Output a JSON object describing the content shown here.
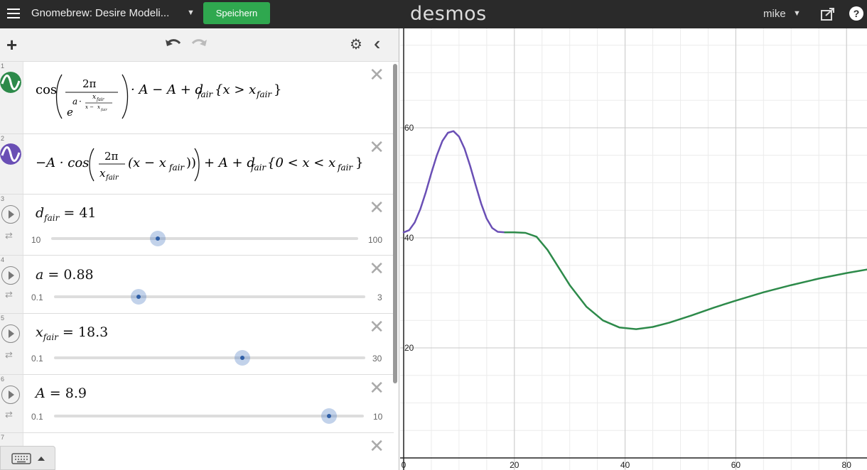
{
  "topbar": {
    "title": "Gnomebrew: Desire Modeli...",
    "save_label": "Speichern",
    "logo": "desmos",
    "user": "mike",
    "help": "?"
  },
  "colors": {
    "topbar": "#2a2a2a",
    "save_button": "#2fa84f",
    "expr1_curve": "#2d8a4a",
    "expr2_curve": "#6a4fb5"
  },
  "expressions": [
    {
      "index": "1",
      "icon": "green-curve-icon"
    },
    {
      "index": "2",
      "icon": "purple-curve-icon"
    },
    {
      "index": "3",
      "slider": {
        "name": "d_fair",
        "value": "41",
        "min": "10",
        "max": "100"
      }
    },
    {
      "index": "4",
      "slider": {
        "name": "a",
        "value": "0.88",
        "min": "0.1",
        "max": "3"
      }
    },
    {
      "index": "5",
      "slider": {
        "name": "x_fair",
        "value": "18.3",
        "min": "0.1",
        "max": "30"
      }
    },
    {
      "index": "6",
      "slider": {
        "name": "A",
        "value": "8.9",
        "min": "0.1",
        "max": "10"
      }
    },
    {
      "index": "7"
    }
  ],
  "math": {
    "expr1": {
      "cos": "cos",
      "numerator": "2π",
      "a": "a",
      "dot": "·",
      "x": "x",
      "fair": "fair",
      "x_minus": "x −",
      "e": "e",
      "rest": "· A − A + d",
      "cond": "{x > x",
      "cond_close": "}"
    },
    "expr2": {
      "lead": "−A  · cos",
      "numerator": "2π",
      "denominator": "x",
      "fair": "fair",
      "paren": "(x − x",
      "paren_close": "))",
      "rest": "+ A + d",
      "cond": "{0 < x  < x",
      "cond_close": "}"
    },
    "expr3": {
      "lhs": "d",
      "sub": "fair",
      "eq": " = 41"
    },
    "expr4": {
      "lhs": "a",
      "eq": " = 0.88"
    },
    "expr5": {
      "lhs": "x",
      "sub": "fair",
      "eq": " = 18.3"
    },
    "expr6": {
      "lhs": "A",
      "eq": " = 8.9"
    }
  },
  "chart_data": {
    "type": "line",
    "x_ticks": [
      "0",
      "20",
      "40",
      "60",
      "80"
    ],
    "y_ticks": [
      "20",
      "40",
      "60"
    ],
    "xlim": [
      0,
      84
    ],
    "ylim": [
      0,
      75
    ],
    "grid": true,
    "series": [
      {
        "color": "#6a4fb5",
        "x": [
          0,
          1,
          2,
          3,
          4,
          5,
          6,
          7,
          8,
          9,
          10,
          11,
          12,
          13,
          14,
          15,
          16,
          17,
          18.3
        ],
        "y": [
          41,
          41.4,
          42.8,
          45.2,
          48.3,
          51.8,
          55.0,
          57.6,
          59.1,
          59.4,
          58.4,
          56.2,
          53.1,
          49.6,
          46.2,
          43.5,
          41.8,
          41.1,
          41
        ]
      },
      {
        "color": "#2d8a4a",
        "x": [
          18.3,
          20,
          22,
          24,
          26,
          28,
          30,
          33,
          36,
          39,
          42,
          45,
          48,
          52,
          56,
          60,
          65,
          70,
          75,
          80,
          84
        ],
        "y": [
          41,
          41,
          40.9,
          40.2,
          37.8,
          34.6,
          31.4,
          27.5,
          25.0,
          23.7,
          23.4,
          23.8,
          24.6,
          25.9,
          27.3,
          28.6,
          30.1,
          31.4,
          32.6,
          33.6,
          34.3
        ]
      }
    ]
  }
}
